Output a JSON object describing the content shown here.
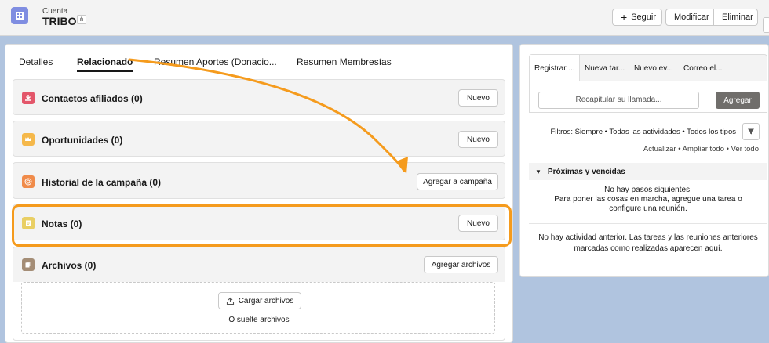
{
  "header": {
    "kicker": "Cuenta",
    "title": "TRIBO",
    "follow_label": "Seguir",
    "edit_label": "Modificar",
    "delete_label": "Eliminar"
  },
  "tabs": [
    "Detalles",
    "Relacionado",
    "Resumen Aportes (Donacio...",
    "Resumen Membresías"
  ],
  "related": [
    {
      "title": "Contactos afiliados (0)",
      "button": "Nuevo",
      "color": "#e3566a",
      "icon": "contacts-icon"
    },
    {
      "title": "Oportunidades (0)",
      "button": "Nuevo",
      "color": "#f5b84a",
      "icon": "crown-icon"
    },
    {
      "title": "Historial de la campaña (0)",
      "button": "Agregar a campaña",
      "color": "#f08b4a",
      "icon": "target-icon"
    },
    {
      "title": "Notas (0)",
      "button": "Nuevo",
      "color": "#e9cf64",
      "icon": "note-icon"
    },
    {
      "title": "Archivos (0)",
      "button": "Agregar archivos",
      "color": "#a48d76",
      "icon": "files-icon"
    }
  ],
  "files": {
    "upload_label": "Cargar archivos",
    "drop_text": "O suelte archivos"
  },
  "activity": {
    "tabs": [
      "Registrar ...",
      "Nueva tar...",
      "Nuevo ev...",
      "Correo el..."
    ],
    "call_placeholder": "Recapitular su llamada...",
    "add_label": "Agregar",
    "filters": "Filtros: Siempre • Todas las actividades • Todos los tipos",
    "links": "Actualizar • Ampliar todo • Ver todo",
    "section_title": "Próximas y vencidas",
    "empty_line1": "No hay pasos siguientes.",
    "empty_line2": "Para poner las cosas en marcha, agregue una tarea o configure una reunión.",
    "empty_past": "No hay actividad anterior. Las tareas y las reuniones anteriores marcadas como realizadas aparecen aquí."
  },
  "colors": {
    "accent_orange": "#f59b1d",
    "account_icon": "#7f8de1"
  }
}
